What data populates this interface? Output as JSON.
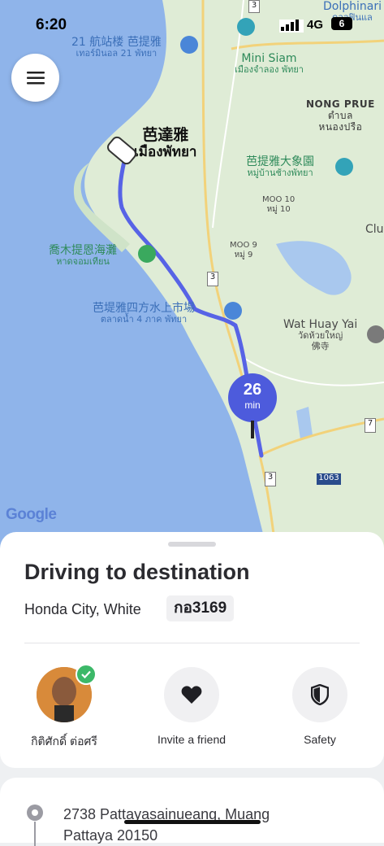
{
  "status_bar": {
    "time": "6:20",
    "network": "4G",
    "battery": "6"
  },
  "map": {
    "labels": {
      "terminal_cn": "21 航站楼 芭提雅",
      "terminal_th": "เทอร์มินอล 21 พัทยา",
      "minisiam_en": "Mini Siam",
      "minisiam_th": "เมืองจำลอง พัทยา",
      "nongprue_en": "NONG PRUE",
      "nongprue_th1": "ตำบล",
      "nongprue_th2": "หนองปรือ",
      "pattaya_cn": "芭達雅",
      "pattaya_th": "เมืองพัทยา",
      "elephant_cn": "芭提雅大象園",
      "elephant_th": "หมู่บ้านช้างพัทยา",
      "moo10_en": "MOO 10",
      "moo10_th": "หมู่ 10",
      "moo9_en": "MOO 9",
      "moo9_th": "หมู่ 9",
      "beach_cn": "喬木提恩海灘",
      "beach_th": "หาดจอมเทียน",
      "market_cn": "芭堤雅四方水上市場",
      "market_th": "ตลาดน้ำ 4 ภาค พัทยา",
      "wat_en": "Wat Huay Yai",
      "wat_th": "วัดห้วยใหญ่",
      "wat_cn": "佛寺",
      "dolphin": "Dolphinari",
      "dolphin_th": "ดอลฟินแล",
      "clu": "Clu"
    },
    "road_shields": [
      "3",
      "3",
      "3",
      "7",
      "1063"
    ],
    "eta": {
      "value": "26",
      "unit": "min"
    },
    "attribution": "Google"
  },
  "trip": {
    "title": "Driving to destination",
    "car": "Honda City, White",
    "plate": "กอ3169"
  },
  "actions": [
    {
      "label": "กิติศักดิ์ ต่อศรี",
      "icon": "driver-avatar"
    },
    {
      "label": "Invite a friend",
      "icon": "heart-icon"
    },
    {
      "label": "Safety",
      "icon": "shield-icon"
    }
  ],
  "destination": {
    "line1": "2738 Pattayasainueang, Muang",
    "line2": "Pattaya 20150"
  },
  "colors": {
    "route": "#5763e6",
    "eta_bubble": "#4d5bdc",
    "verified": "#3cb868",
    "sea": "#8fb4ea",
    "land": "#dfecd6"
  }
}
